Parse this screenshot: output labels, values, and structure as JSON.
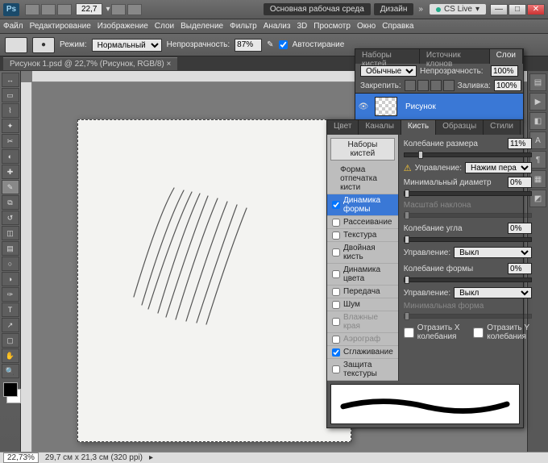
{
  "titlebar": {
    "zoom": "22,7",
    "workspace_main": "Основная рабочая среда",
    "workspace_design": "Дизайн",
    "cslive": "CS Live"
  },
  "menu": [
    "Файл",
    "Редактирование",
    "Изображение",
    "Слои",
    "Выделение",
    "Фильтр",
    "Анализ",
    "3D",
    "Просмотр",
    "Окно",
    "Справка"
  ],
  "options": {
    "mode_label": "Режим:",
    "mode_value": "Нормальный",
    "opacity_label": "Непрозрачность:",
    "opacity_value": "87%",
    "auto_erase": "Автостирание"
  },
  "document_tab": "Рисунок 1.psd @ 22,7% (Рисунок, RGB/8)",
  "layers_panel": {
    "tabs": [
      "Наборы кистей",
      "Источник клонов",
      "Слои"
    ],
    "blend_label": "Обычные",
    "opacity_label": "Непрозрачность:",
    "opacity_value": "100%",
    "lock_label": "Закрепить:",
    "fill_label": "Заливка:",
    "fill_value": "100%",
    "layer_name": "Рисунок"
  },
  "brush_panel": {
    "tabs": [
      "Цвет",
      "Каналы",
      "Кисть",
      "Образцы",
      "Стили"
    ],
    "presets_btn": "Наборы кистей",
    "items": [
      {
        "label": "Форма отпечатка кисти",
        "checked": null
      },
      {
        "label": "Динамика формы",
        "checked": true,
        "sel": true
      },
      {
        "label": "Рассеивание",
        "checked": false
      },
      {
        "label": "Текстура",
        "checked": false
      },
      {
        "label": "Двойная кисть",
        "checked": false
      },
      {
        "label": "Динамика цвета",
        "checked": false
      },
      {
        "label": "Передача",
        "checked": false
      },
      {
        "label": "Шум",
        "checked": false
      },
      {
        "label": "Влажные края",
        "checked": false,
        "dis": true
      },
      {
        "label": "Аэрограф",
        "checked": false,
        "dis": true
      },
      {
        "label": "Сглаживание",
        "checked": true
      },
      {
        "label": "Защита текстуры",
        "checked": false
      }
    ],
    "size_jitter_label": "Колебание размера",
    "size_jitter_value": "11%",
    "control_label": "Управление:",
    "control_value": "Нажим пера",
    "min_diam_label": "Минимальный диаметр",
    "min_diam_value": "0%",
    "tilt_scale_label": "Масштаб наклона",
    "angle_jitter_label": "Колебание угла",
    "angle_jitter_value": "0%",
    "angle_ctrl_value": "Выкл",
    "round_jitter_label": "Колебание формы",
    "round_jitter_value": "0%",
    "round_ctrl_value": "Выкл",
    "min_round_label": "Минимальная форма",
    "flip_x": "Отразить X колебания",
    "flip_y": "Отразить Y колебания"
  },
  "status": {
    "zoom": "22,73%",
    "doc_size": "29,7 см x 21,3 см (320 ppi)"
  }
}
